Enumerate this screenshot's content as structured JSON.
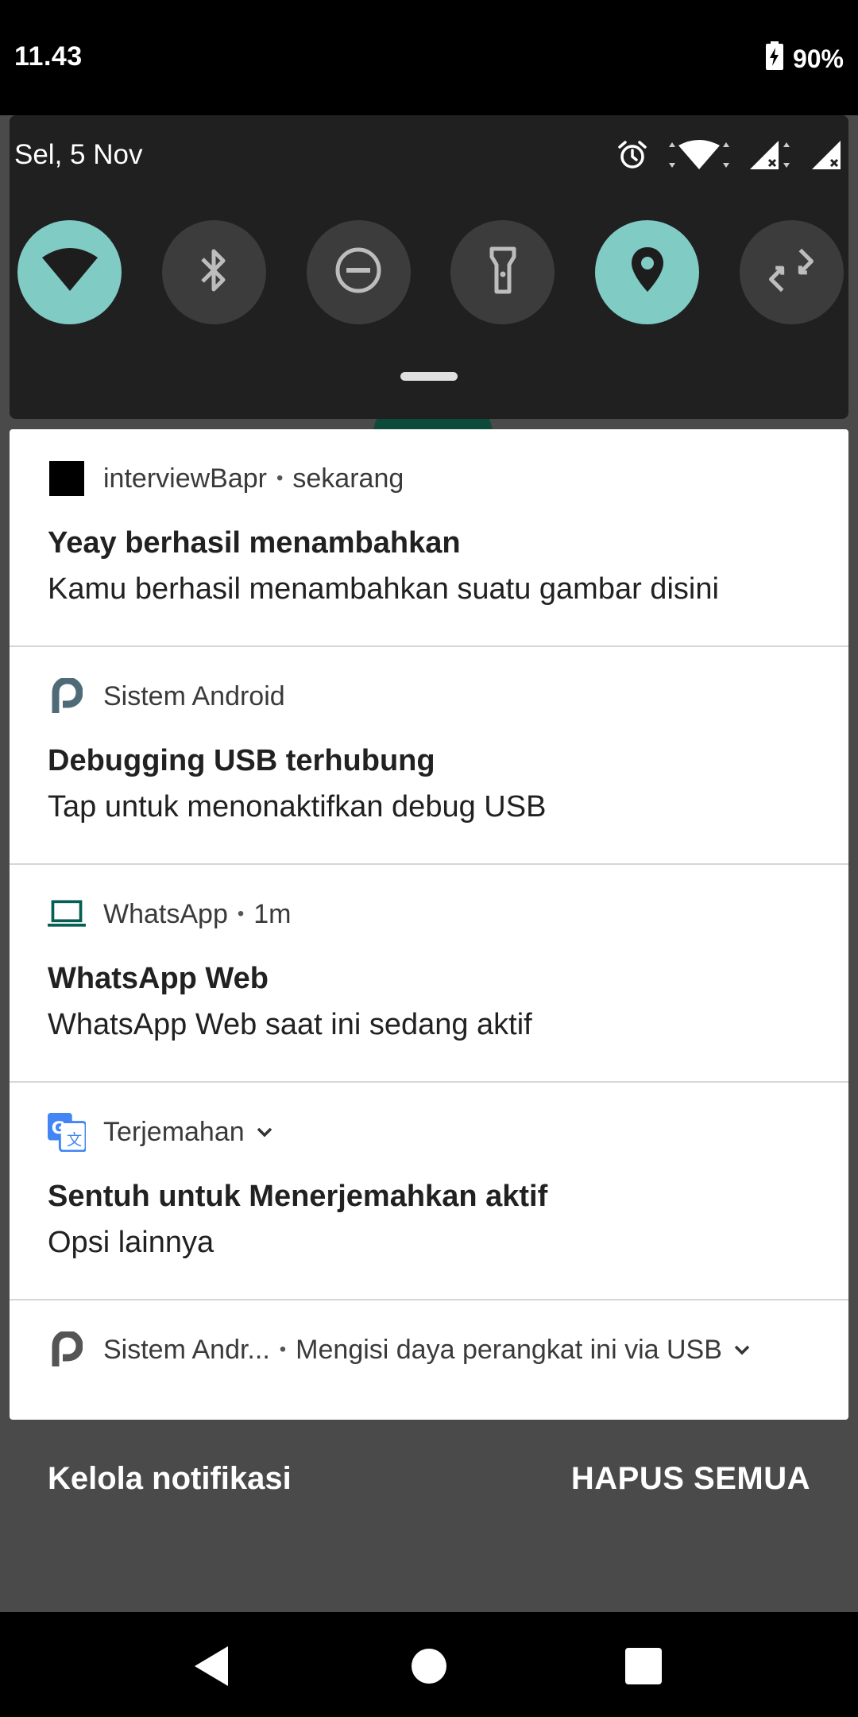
{
  "status_bar": {
    "time": "11.43",
    "battery": "90%"
  },
  "quick_settings": {
    "date": "Sel, 5 Nov",
    "tiles": [
      {
        "name": "wifi",
        "active": true
      },
      {
        "name": "bluetooth",
        "active": false
      },
      {
        "name": "do-not-disturb",
        "active": false
      },
      {
        "name": "flashlight",
        "active": false
      },
      {
        "name": "location",
        "active": true
      },
      {
        "name": "auto-rotate",
        "active": false
      }
    ],
    "accent_color": "#80cbc4"
  },
  "notifications": [
    {
      "app": "interviewBapr",
      "time": "sekarang",
      "title": "Yeay berhasil menambahkan",
      "text": "Kamu berhasil menambahkan suatu gambar disini",
      "icon": "square-app-icon"
    },
    {
      "app": "Sistem Android",
      "title": "Debugging USB terhubung",
      "text": "Tap untuk menonaktifkan debug USB",
      "icon": "android-system-icon"
    },
    {
      "app": "WhatsApp",
      "time": "1m",
      "title": "WhatsApp Web",
      "text": "WhatsApp Web saat ini sedang aktif",
      "icon": "laptop-icon",
      "icon_color": "#075e54"
    },
    {
      "app": "Terjemahan",
      "title": "Sentuh untuk Menerjemahkan aktif",
      "text": "Opsi lainnya",
      "icon": "translate-icon",
      "icon_color": "#1a73e8"
    },
    {
      "app": "Sistem Andr...",
      "summary": "Mengisi daya perangkat ini via USB",
      "icon": "android-system-icon"
    }
  ],
  "footer": {
    "manage_label": "Kelola notifikasi",
    "clear_label": "HAPUS SEMUA"
  }
}
